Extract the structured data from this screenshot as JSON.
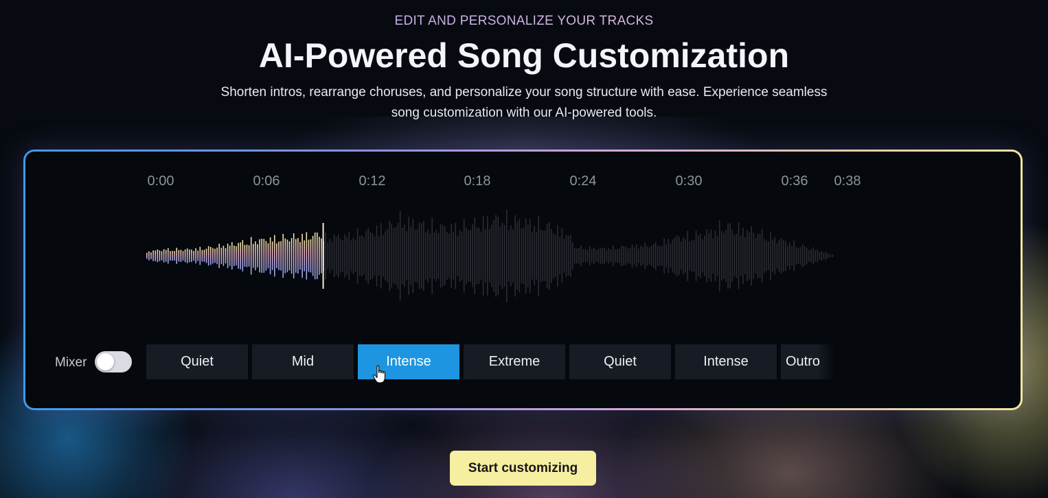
{
  "header": {
    "eyebrow": "EDIT AND PERSONALIZE YOUR TRACKS",
    "title": "AI-Powered Song Customization",
    "subtitle_line1": "Shorten intros, rearrange choruses, and personalize your song structure with ease. Experience seamless",
    "subtitle_line2": "song customization with our AI-powered tools."
  },
  "timeline": {
    "labels": [
      "0:00",
      "0:06",
      "0:12",
      "0:18",
      "0:24",
      "0:30",
      "0:36",
      "0:38"
    ]
  },
  "waveform": {
    "duration_seconds": 38,
    "played_seconds": 9.8,
    "played_gradient": [
      "#f0e6a0",
      "#e4b0c8",
      "#8fa2ee"
    ],
    "unplayed_color": "#2a2d33"
  },
  "mixer": {
    "label": "Mixer",
    "enabled": false
  },
  "segments": [
    {
      "label": "Quiet",
      "active": false
    },
    {
      "label": "Mid",
      "active": false
    },
    {
      "label": "Intense",
      "active": true
    },
    {
      "label": "Extreme",
      "active": false
    },
    {
      "label": "Quiet",
      "active": false
    },
    {
      "label": "Intense",
      "active": false
    },
    {
      "label": "Outro",
      "active": false
    }
  ],
  "cta": {
    "label": "Start customizing"
  },
  "colors": {
    "accent_active": "#1d95e0",
    "cta_background": "#f6eea0",
    "page_background": "#070b11"
  },
  "icons": {
    "pointer": "hand-pointer-icon"
  }
}
